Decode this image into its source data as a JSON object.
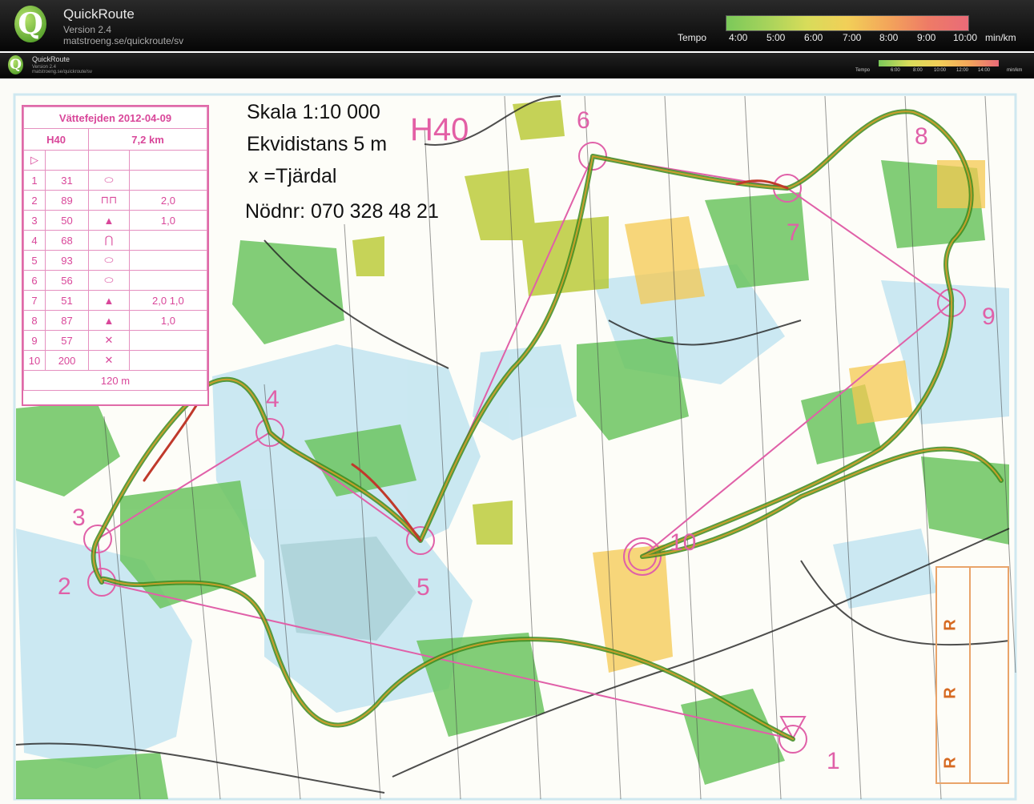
{
  "header": {
    "app_name": "QuickRoute",
    "version": "Version 2.4",
    "url": "matstroeng.se/quickroute/sv",
    "logo_letter": "Q",
    "legend_title": "Tempo",
    "legend_unit": "min/km",
    "legend_ticks": [
      "4:00",
      "5:00",
      "6:00",
      "7:00",
      "8:00",
      "9:00",
      "10:00"
    ]
  },
  "subheader": {
    "app_name": "QuickRoute",
    "version": "Version 2.4",
    "url": "matstroeng.se/quickroute/sv",
    "legend_title": "Tempo",
    "legend_unit": "min/km",
    "legend_ticks": [
      "6:00",
      "8:00",
      "10:00",
      "12:00",
      "14:00"
    ]
  },
  "map": {
    "scale": "Skala 1:10 000",
    "contour": "Ekvidistans 5 m",
    "symbol_note": "x =Tjärdal",
    "emergency": "Nödnr: 070 328 48 21",
    "class_label": "H40",
    "control_numbers": [
      "1",
      "2",
      "3",
      "4",
      "5",
      "6",
      "7",
      "8",
      "9",
      "10"
    ],
    "restricted_marks": [
      "R",
      "R",
      "R"
    ]
  },
  "description_sheet": {
    "event": "Vättefejden 2012-04-09",
    "class": "H40",
    "distance": "7,2 km",
    "rows": [
      {
        "num": "1",
        "code": "31",
        "extra": ""
      },
      {
        "num": "2",
        "code": "89",
        "extra": "2,0"
      },
      {
        "num": "3",
        "code": "50",
        "extra": "1,0"
      },
      {
        "num": "4",
        "code": "68",
        "extra": ""
      },
      {
        "num": "5",
        "code": "93",
        "extra": ""
      },
      {
        "num": "6",
        "code": "56",
        "extra": ""
      },
      {
        "num": "7",
        "code": "51",
        "extra": "2,0 1,0"
      },
      {
        "num": "8",
        "code": "87",
        "extra": "1,0"
      },
      {
        "num": "9",
        "code": "57",
        "extra": ""
      },
      {
        "num": "10",
        "code": "200",
        "extra": ""
      }
    ],
    "finish": "120 m"
  },
  "colors": {
    "course": "#e060a8",
    "route_green": "#3d8a1e",
    "route_red": "#c0392b",
    "forest": "#6cc460",
    "water": "#bde3ef",
    "open": "#f4c850"
  }
}
